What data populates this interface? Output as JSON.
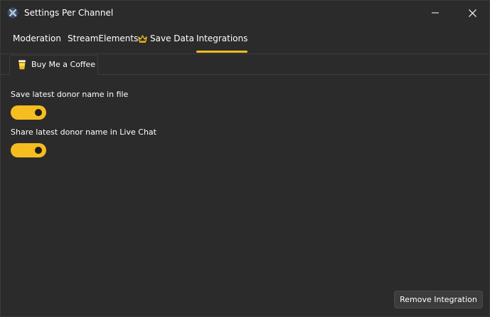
{
  "window": {
    "title": "Settings Per Channel",
    "app_icon": "app-logo-icon"
  },
  "main_tabs": [
    {
      "label": "Moderation",
      "active": false
    },
    {
      "label": "StreamElements",
      "active": false
    },
    {
      "label": "Save Data",
      "active": false,
      "icon": "crown-icon"
    },
    {
      "label": "Integrations",
      "active": true
    }
  ],
  "sub_tabs": [
    {
      "label": "Buy Me a Coffee",
      "icon": "coffee-cup-icon",
      "active": true
    }
  ],
  "settings": [
    {
      "label": "Save latest donor name in file",
      "enabled": true
    },
    {
      "label": "Share latest donor name in Live Chat",
      "enabled": true
    }
  ],
  "actions": {
    "remove_label": "Remove Integration"
  },
  "colors": {
    "accent": "#f5bd1f",
    "background": "#2b2b2b",
    "button_bg": "#3c3c3c"
  }
}
